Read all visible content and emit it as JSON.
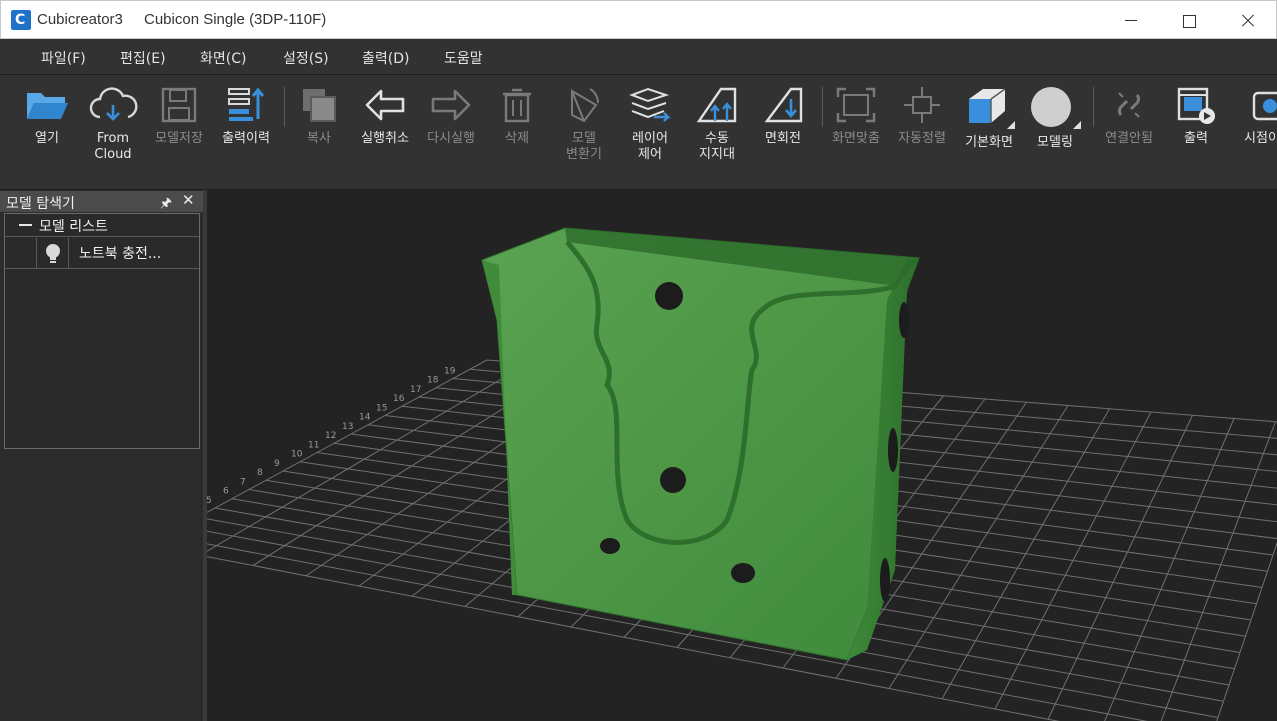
{
  "window": {
    "app_name": "Cubicreator3",
    "title": "Cubicon Single (3DP-110F)"
  },
  "menu": [
    {
      "label": "파일(F)"
    },
    {
      "label": "편집(E)"
    },
    {
      "label": "화면(C)"
    },
    {
      "label": "설정(S)"
    },
    {
      "label": "출력(D)"
    },
    {
      "label": "도움말"
    }
  ],
  "toolbar": [
    {
      "label": "열기",
      "icon": "folder-open-icon",
      "enabled": true
    },
    {
      "label": "From\nCloud",
      "icon": "cloud-download-icon",
      "enabled": true
    },
    {
      "label": "모델저장",
      "icon": "save-icon",
      "enabled": false
    },
    {
      "label": "출력이력",
      "icon": "print-history-icon",
      "enabled": true
    },
    {
      "label": "복사",
      "icon": "copy-icon",
      "enabled": false
    },
    {
      "label": "실행취소",
      "icon": "undo-icon",
      "enabled": true
    },
    {
      "label": "다시실행",
      "icon": "redo-icon",
      "enabled": false
    },
    {
      "label": "삭제",
      "icon": "trash-icon",
      "enabled": false
    },
    {
      "label": "모델\n변환기",
      "icon": "model-converter-icon",
      "enabled": false
    },
    {
      "label": "레이어\n제어",
      "icon": "layers-icon",
      "enabled": true
    },
    {
      "label": "수동\n지지대",
      "icon": "manual-support-icon",
      "enabled": true
    },
    {
      "label": "면회전",
      "icon": "face-rotate-icon",
      "enabled": true
    },
    {
      "label": "화면맞춤",
      "icon": "fit-screen-icon",
      "enabled": false
    },
    {
      "label": "자동정렬",
      "icon": "auto-arrange-icon",
      "enabled": false
    },
    {
      "label": "기본화면",
      "icon": "default-view-cube-icon",
      "enabled": true
    },
    {
      "label": "모델링",
      "icon": "modeling-sphere-icon",
      "enabled": true
    },
    {
      "label": "연결안됨",
      "icon": "disconnected-link-icon",
      "enabled": false
    },
    {
      "label": "출력",
      "icon": "print-icon",
      "enabled": true
    },
    {
      "label": "시점이",
      "icon": "camera-viewpoint-icon",
      "enabled": true
    }
  ],
  "explorer": {
    "title": "모델 탐색기",
    "pin_icon": "pin-icon",
    "close_icon": "close-icon",
    "root_label": "모델 리스트",
    "items": [
      {
        "name": "노트북 충전...",
        "icon": "bulb-icon"
      }
    ]
  },
  "viewport": {
    "model_color": "#4a9a45",
    "grid_labels": [
      "3",
      "4",
      "5",
      "6",
      "7",
      "8",
      "9",
      "10",
      "11",
      "12",
      "13",
      "14",
      "15",
      "16",
      "17",
      "18",
      "19"
    ]
  }
}
